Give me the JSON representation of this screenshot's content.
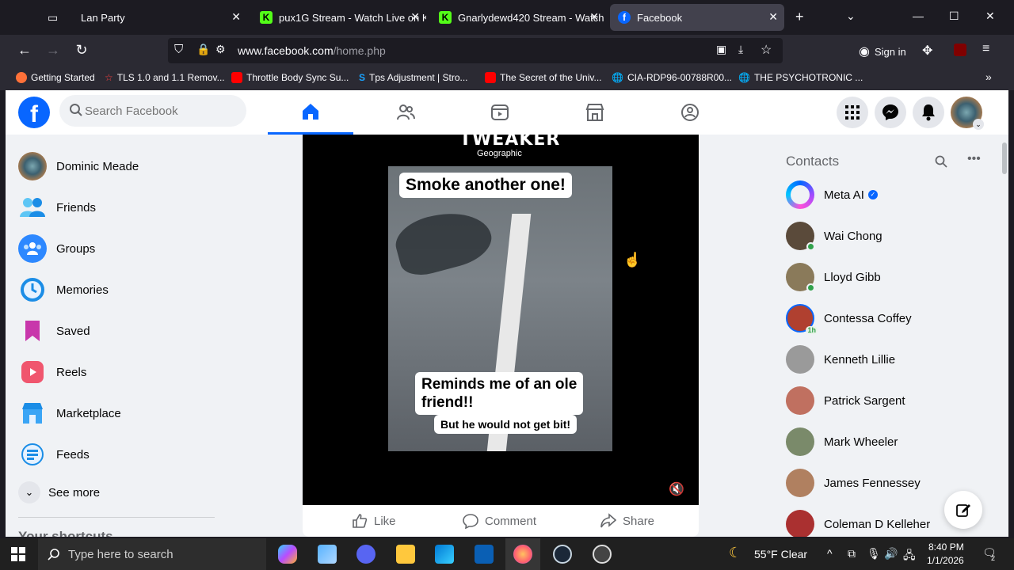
{
  "browser": {
    "tabs": [
      {
        "label": "Lan Party",
        "icon": "tab-group-icon"
      },
      {
        "label": "pux1G Stream - Watch Live on K",
        "icon": "kick-icon"
      },
      {
        "label": "Gnarlydewd420 Stream - Watch",
        "icon": "kick-icon"
      },
      {
        "label": "Facebook",
        "icon": "facebook-icon"
      }
    ],
    "url_host": "www.facebook.com",
    "url_path": "/home.php",
    "signin": "Sign in",
    "bookmarks": [
      "Getting Started",
      "TLS 1.0 and 1.1 Remov...",
      "Throttle Body Sync Su...",
      "Tps Adjustment | Stro...",
      "The Secret of the Univ...",
      "CIA-RDP96-00788R00...",
      "THE PSYCHOTRONIC ..."
    ]
  },
  "fb": {
    "search_placeholder": "Search Facebook",
    "sidebar": [
      {
        "label": "Dominic Meade",
        "icon": "profile-avatar"
      },
      {
        "label": "Friends",
        "icon": "friends-icon"
      },
      {
        "label": "Groups",
        "icon": "groups-icon"
      },
      {
        "label": "Memories",
        "icon": "memories-icon"
      },
      {
        "label": "Saved",
        "icon": "saved-icon"
      },
      {
        "label": "Reels",
        "icon": "reels-icon"
      },
      {
        "label": "Marketplace",
        "icon": "marketplace-icon"
      },
      {
        "label": "Feeds",
        "icon": "feeds-icon"
      }
    ],
    "see_more": "See more",
    "shortcuts_heading": "Your shortcuts",
    "video": {
      "watermark": "TWEAKER",
      "watermark_sub": "Geographic",
      "caption_top": "Smoke another one!",
      "caption_mid_1": "Reminds me of an ole",
      "caption_mid_2": "friend!!",
      "caption_bottom": "But he would not get bit!"
    },
    "actions": {
      "like": "Like",
      "comment": "Comment",
      "share": "Share"
    },
    "contacts_title": "Contacts",
    "contacts": [
      {
        "name": "Meta AI",
        "verified": true,
        "online": false,
        "color": "#a0a0ff"
      },
      {
        "name": "Wai Chong",
        "online": true,
        "color": "#5a4a3a"
      },
      {
        "name": "Lloyd Gibb",
        "online": true,
        "color": "#8a7a5a"
      },
      {
        "name": "Contessa Coffey",
        "online": false,
        "badge": "1h",
        "color": "#b04030"
      },
      {
        "name": "Kenneth Lillie",
        "online": false,
        "color": "#9a9a9a"
      },
      {
        "name": "Patrick Sargent",
        "online": false,
        "color": "#c07060"
      },
      {
        "name": "Mark Wheeler",
        "online": false,
        "color": "#7a8a6a"
      },
      {
        "name": "James Fennessey",
        "online": false,
        "color": "#b08060"
      },
      {
        "name": "Coleman D Kelleher",
        "online": false,
        "color": "#aa3030"
      }
    ]
  },
  "taskbar": {
    "search_placeholder": "Type here to search",
    "weather": "55°F  Clear",
    "time": "8:40 PM",
    "date": "1/1/2026",
    "notifications": "2"
  }
}
